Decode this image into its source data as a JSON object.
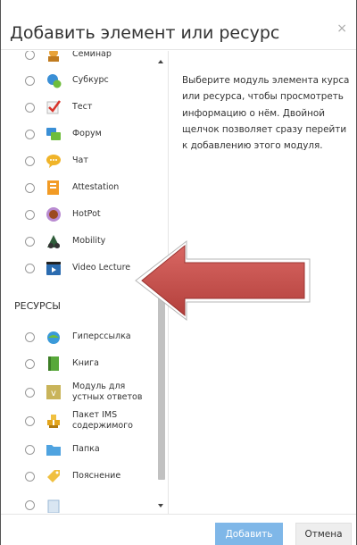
{
  "dialog": {
    "title": "Добавить элемент или ресурс",
    "close_glyph": "×"
  },
  "activities": [
    {
      "label": "Семинар",
      "icon": "workshop-icon"
    },
    {
      "label": "Субкурс",
      "icon": "subcourse-icon"
    },
    {
      "label": "Тест",
      "icon": "quiz-icon"
    },
    {
      "label": "Форум",
      "icon": "forum-icon"
    },
    {
      "label": "Чат",
      "icon": "chat-icon"
    },
    {
      "label": "Attestation",
      "icon": "attestation-icon"
    },
    {
      "label": "HotPot",
      "icon": "hotpot-icon"
    },
    {
      "label": "Mobility",
      "icon": "mobility-icon"
    },
    {
      "label": "Video Lecture",
      "icon": "video-lecture-icon"
    }
  ],
  "resources_heading": "РЕСУРСЫ",
  "resources": [
    {
      "label": "Гиперссылка",
      "icon": "url-icon"
    },
    {
      "label": "Книга",
      "icon": "book-icon"
    },
    {
      "label": "Модуль для устных ответов",
      "icon": "oral-answer-icon"
    },
    {
      "label": "Пакет IMS содержимого",
      "icon": "ims-package-icon"
    },
    {
      "label": "Папка",
      "icon": "folder-icon"
    },
    {
      "label": "Пояснение",
      "icon": "label-icon"
    }
  ],
  "description": "Выберите модуль элемента курса или ресурса, чтобы просмотреть информацию о нём. Двойной щелчок позволяет сразу перейти к добавлению этого модуля.",
  "footer": {
    "add_label": "Добавить",
    "cancel_label": "Отмена"
  },
  "colors": {
    "add_button": "#7fb7e8",
    "arrow_fill": "#c0504d",
    "arrow_outline": "#b5b5b5"
  }
}
